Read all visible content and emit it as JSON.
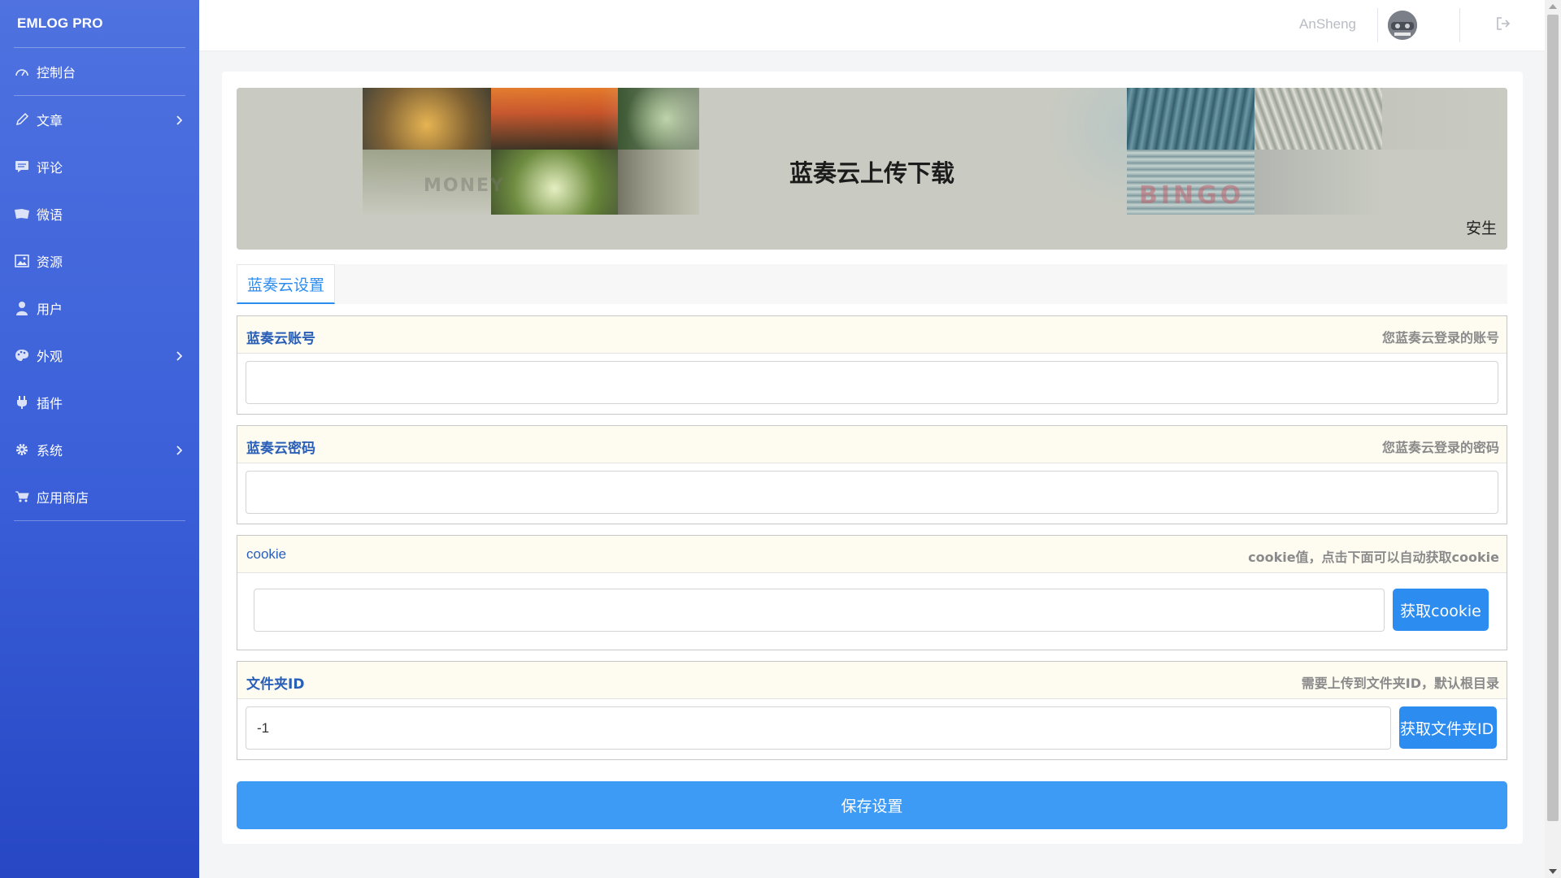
{
  "sidebar": {
    "brand": "EMLOG PRO",
    "items": [
      {
        "label": "控制台",
        "icon": "dashboard-icon"
      },
      {
        "label": "文章",
        "icon": "pencil-icon",
        "expandable": true
      },
      {
        "label": "评论",
        "icon": "comment-icon"
      },
      {
        "label": "微语",
        "icon": "note-icon"
      },
      {
        "label": "资源",
        "icon": "image-icon"
      },
      {
        "label": "用户",
        "icon": "user-icon"
      },
      {
        "label": "外观",
        "icon": "palette-icon",
        "expandable": true
      },
      {
        "label": "插件",
        "icon": "plug-icon"
      },
      {
        "label": "系统",
        "icon": "gear-icon",
        "expandable": true
      },
      {
        "label": "应用商店",
        "icon": "cart-icon"
      }
    ]
  },
  "topbar": {
    "username": "AnSheng",
    "avatar_icon": "avatar-icon",
    "logout_icon": "logout-icon"
  },
  "banner": {
    "title": "蓝奏云上传下载",
    "author": "安生",
    "watermarks": [
      "MONEY",
      "BINGO"
    ]
  },
  "tabs": [
    {
      "label": "蓝奏云设置",
      "active": true
    }
  ],
  "fields": {
    "account": {
      "label": "蓝奏云账号",
      "hint": "您蓝奏云登录的账号",
      "value": ""
    },
    "password": {
      "label": "蓝奏云密码",
      "hint": "您蓝奏云登录的密码",
      "value": ""
    },
    "cookie": {
      "label": "cookie",
      "hint": "cookie值，点击下面可以自动获取cookie",
      "value": "",
      "button": "获取cookie"
    },
    "folder": {
      "label": "文件夹ID",
      "hint": "需要上传到文件夹ID，默认根目录",
      "value": "-1",
      "button": "获取文件夹ID"
    }
  },
  "actions": {
    "save": "保存设置"
  },
  "colors": {
    "sidebar_top": "#4f72e0",
    "sidebar_bottom": "#2747c4",
    "accent": "#2d8cf0",
    "save_button": "#3d9bf6",
    "field_header_bg": "#fefbf1",
    "label_blue": "#2a5fb8"
  }
}
